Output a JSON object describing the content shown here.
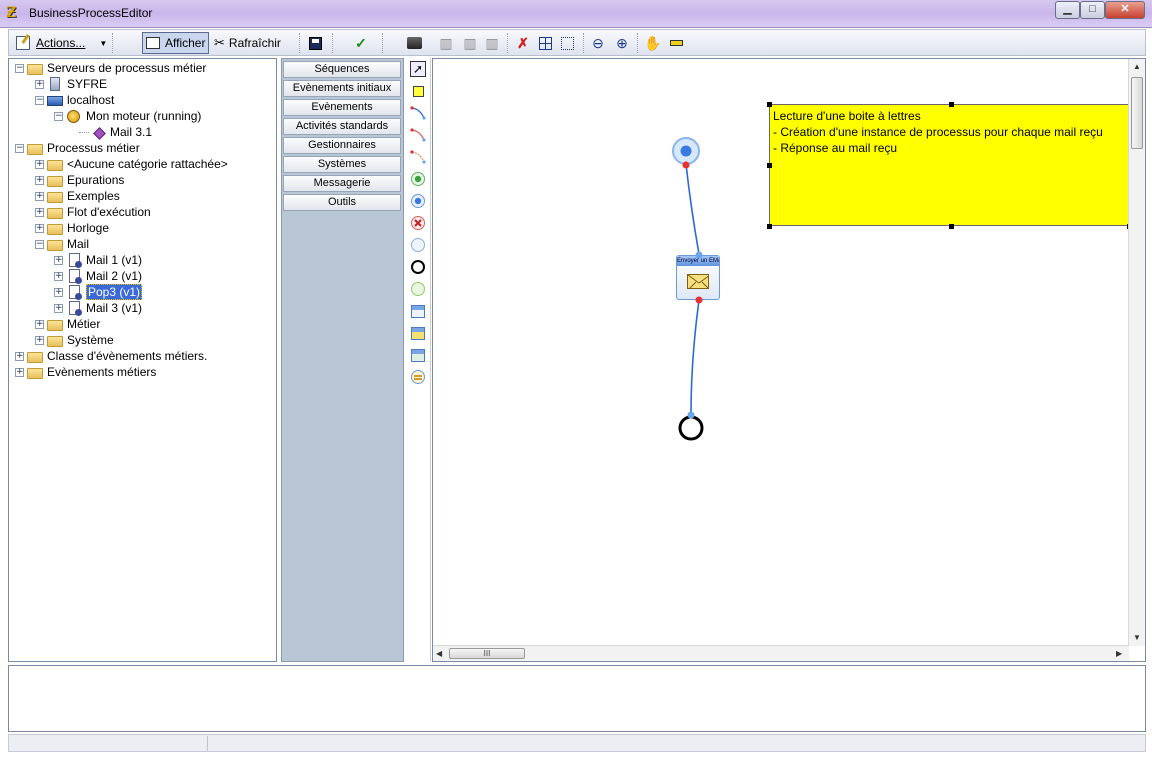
{
  "window": {
    "title": "BusinessProcessEditor",
    "buttons": {
      "minimize": "▁",
      "maximize": "□",
      "close": "✕"
    }
  },
  "toolbar": {
    "actions_label": "Actions...",
    "afficher_label": "Afficher",
    "rafraichir_label": "Rafraîchir",
    "icons": [
      "save-icon",
      "check-icon",
      "print-icon",
      "align-left-icon",
      "align-center-icon",
      "align-right-icon",
      "cut-connector-icon",
      "grid-icon",
      "snap-icon",
      "zoom-out-icon",
      "zoom-in-icon",
      "hand-icon",
      "ruler-icon"
    ]
  },
  "tree": {
    "items": [
      {
        "label": "Serveurs de processus métier",
        "icon": "folder-icon",
        "expander": "−"
      },
      {
        "label": "SYFRE",
        "icon": "server-icon",
        "expander": "+"
      },
      {
        "label": "localhost",
        "icon": "computer-icon",
        "expander": "−"
      },
      {
        "label": "Mon moteur (running)",
        "icon": "engine-icon",
        "expander": "−"
      },
      {
        "label": "Mail 3.1",
        "icon": "diamond-icon",
        "expander": ""
      },
      {
        "label": "Processus métier",
        "icon": "folder-icon",
        "expander": "−"
      },
      {
        "label": "<Aucune catégorie rattachée>",
        "icon": "folder-icon",
        "expander": "+"
      },
      {
        "label": "Epurations",
        "icon": "folder-icon",
        "expander": "+"
      },
      {
        "label": "Exemples",
        "icon": "folder-icon",
        "expander": "+"
      },
      {
        "label": "Flot d'exécution",
        "icon": "folder-icon",
        "expander": "+"
      },
      {
        "label": "Horloge",
        "icon": "folder-icon",
        "expander": "+"
      },
      {
        "label": "Mail",
        "icon": "folder-icon",
        "expander": "−"
      },
      {
        "label": "Mail 1 (v1)",
        "icon": "process-doc-icon",
        "expander": "+"
      },
      {
        "label": "Mail 2 (v1)",
        "icon": "process-doc-icon",
        "expander": "+"
      },
      {
        "label": "Pop3 (v1)",
        "icon": "process-doc-icon",
        "expander": "+",
        "selected": true
      },
      {
        "label": "Mail 3 (v1)",
        "icon": "process-doc-icon",
        "expander": "+"
      },
      {
        "label": "Métier",
        "icon": "folder-icon",
        "expander": "+"
      },
      {
        "label": "Système",
        "icon": "folder-icon",
        "expander": "+"
      },
      {
        "label": "Classe d'évènements métiers.",
        "icon": "folder-icon",
        "expander": "+"
      },
      {
        "label": "Evènements métiers",
        "icon": "folder-icon",
        "expander": "+"
      }
    ]
  },
  "palette": {
    "buttons": [
      "Séquences",
      "Evènements initiaux",
      "Evènements",
      "Activités standards",
      "Gestionnaires",
      "Systèmes",
      "Messagerie",
      "Outils"
    ]
  },
  "icon_strip": {
    "icons": [
      "pointer-icon",
      "note-icon",
      "connector-icon",
      "connector-red-icon",
      "connector-alt-icon",
      "start-green-icon",
      "start-blue-icon",
      "error-event-icon",
      "intermediate-event-icon",
      "end-event-icon",
      "green-event-icon",
      "window-activity-icon",
      "house-activity-icon",
      "chart-activity-icon",
      "loop-icon"
    ]
  },
  "canvas": {
    "note_lines": [
      "Lecture d'une boite à lettres",
      "- Création d'une instance de processus pour chaque mail reçu",
      "- Réponse au mail reçu"
    ],
    "activity_label": "Envoyer un EMail",
    "scroll_grip": "III",
    "colors": {
      "note": "#ffff00",
      "flow_line": "#2a6ad8",
      "start_event": "#4a8cf0",
      "port_red": "#e83030",
      "port_blue": "#6aa6f0"
    }
  }
}
